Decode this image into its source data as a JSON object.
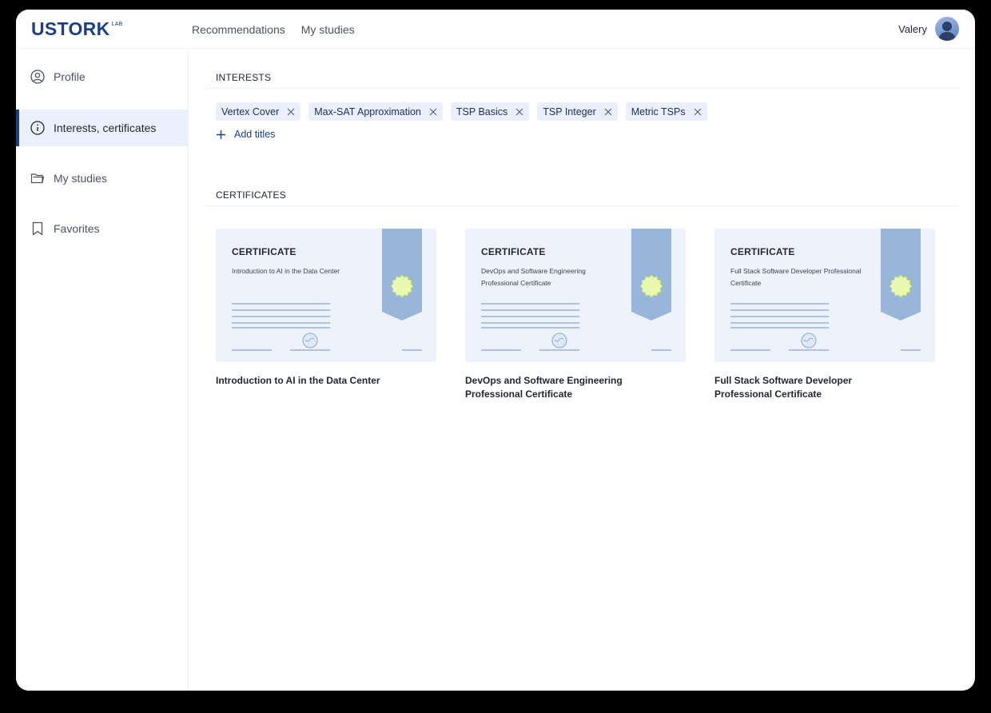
{
  "header": {
    "logo": "USTORK",
    "logo_sup": "LAB",
    "nav": [
      "Recommendations",
      "My studies"
    ],
    "user_name": "Valery"
  },
  "sidebar": {
    "items": [
      {
        "label": "Profile",
        "icon": "user-circle-icon",
        "active": false
      },
      {
        "label": "Interests, certificates",
        "icon": "info-circle-icon",
        "active": true
      },
      {
        "label": "My studies",
        "icon": "folder-icon",
        "active": false
      },
      {
        "label": "Favorites",
        "icon": "bookmark-icon",
        "active": false
      }
    ]
  },
  "interests": {
    "title": "INTERESTS",
    "chips": [
      "Vertex Cover",
      "Max-SAT Approximation",
      "TSP Basics",
      "TSP Integer",
      "Metric TSPs"
    ],
    "add_label": "Add titles"
  },
  "certificates": {
    "title": "CERTIFICATES",
    "heading": "CERTIFICATE",
    "items": [
      {
        "subtitle": "Introduction to AI in the Data Center",
        "title": "Introduction to AI in the Data Center"
      },
      {
        "subtitle": "DevOps and Software Engineering Professional Certificate",
        "title": "DevOps and Software Engineering Professional Certificate"
      },
      {
        "subtitle": "Full Stack Software Developer Professional Certificate",
        "title": "Full Stack Software Developer Professional Certificate"
      }
    ]
  },
  "colors": {
    "brand": "#1d3f8a",
    "active_bg": "#eaf1fd",
    "chip_bg": "#e9effb",
    "cert_bg": "#edf2fd",
    "ribbon": "#98b6da",
    "seal": "#eaf9b0"
  }
}
